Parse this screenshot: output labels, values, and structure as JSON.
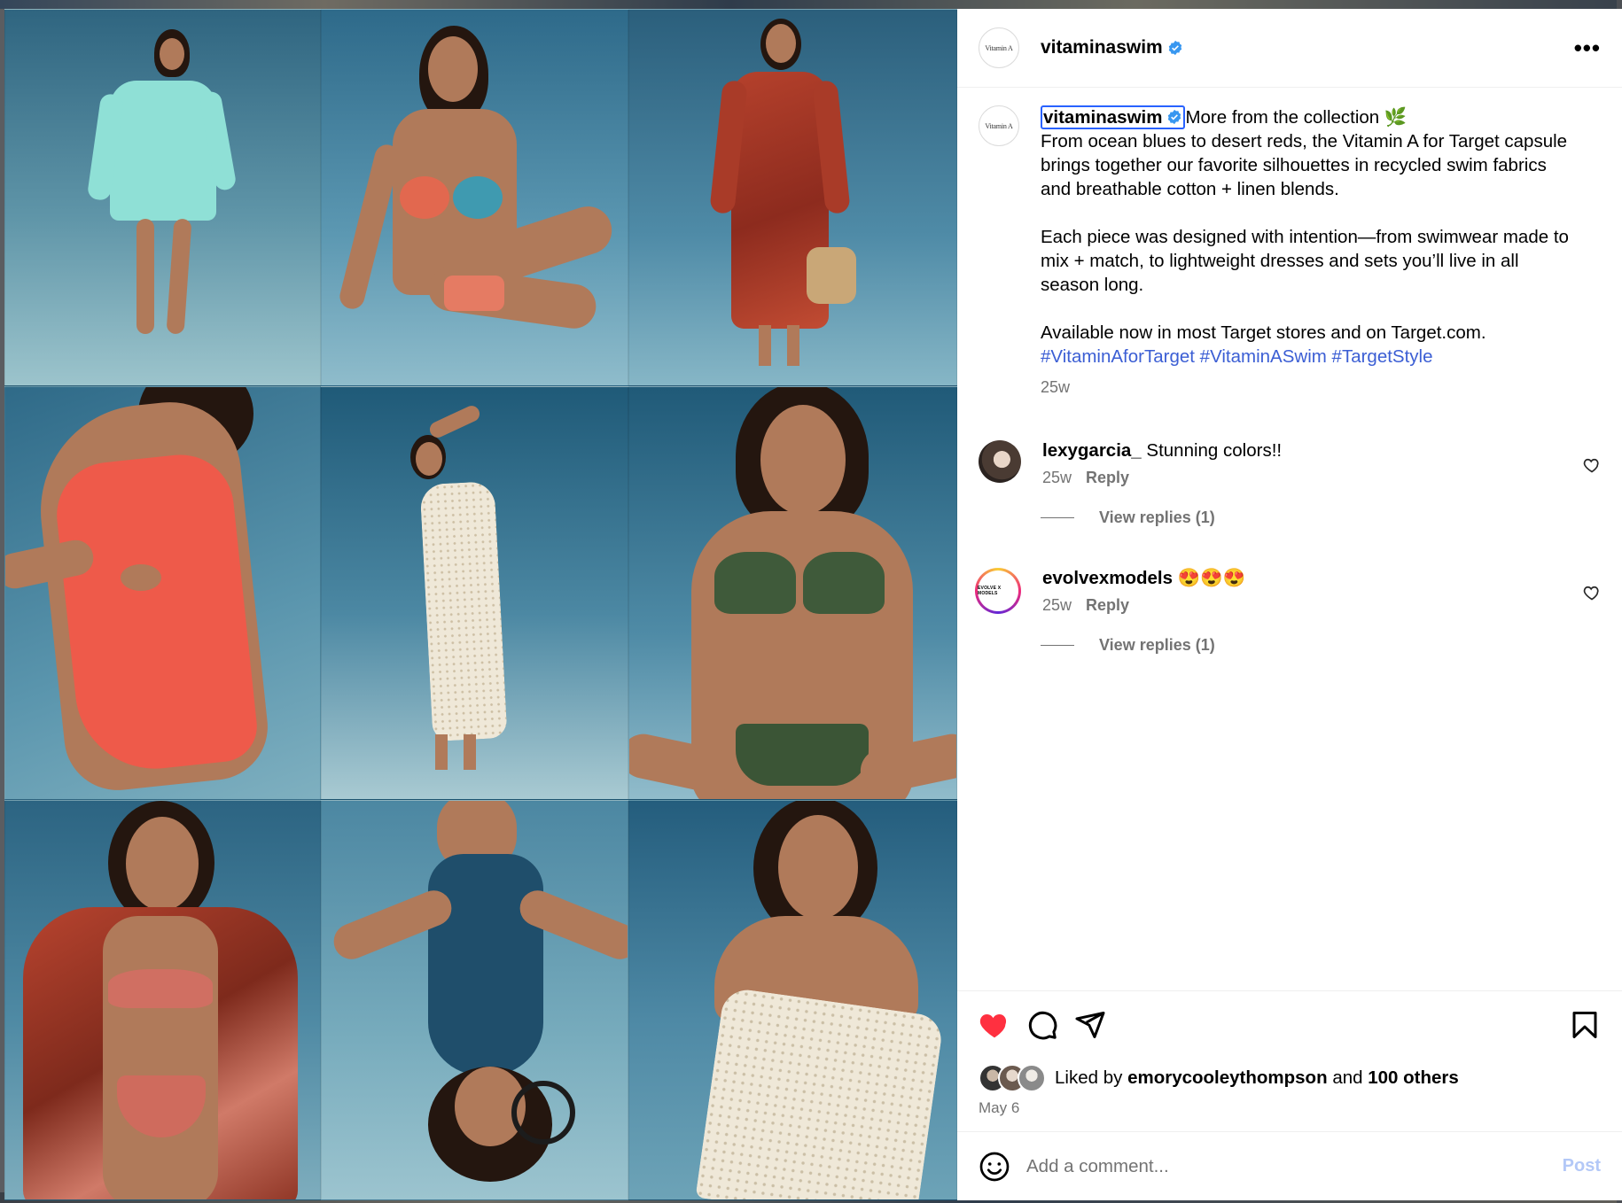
{
  "post": {
    "username": "vitaminaswim",
    "avatar_text": "Vitamin A",
    "verified_icon": "verified-badge-icon",
    "more_icon": "more-options-icon"
  },
  "caption": {
    "username": "vitaminaswim",
    "text_first": "More from the collection 🌿",
    "text_rest": "From ocean blues to desert reds, the Vitamin A for Target capsule brings together our favorite silhouettes in recycled swim fabrics and breathable cotton + linen blends.\n\nEach piece was designed with intention—from swimwear made to mix + match, to lightweight dresses and sets you’ll live in all season long.\n\nAvailable now in most Target stores and on Target.com.",
    "hashtags": [
      "#VitaminAforTarget",
      "#VitaminASwim",
      "#TargetStyle"
    ],
    "time": "25w"
  },
  "comments": [
    {
      "username": "lexygarcia_",
      "text": "Stunning colors!!",
      "time": "25w",
      "reply_label": "Reply",
      "view_replies": "View replies (1)"
    },
    {
      "username": "evolvexmodels",
      "text": "😍😍😍",
      "time": "25w",
      "reply_label": "Reply",
      "view_replies": "View replies (1)",
      "avatar_text": "EVOLVE X MODELS"
    }
  ],
  "likes": {
    "prefix": "Liked by",
    "top_user": "emorycooleythompson",
    "and": "and",
    "others": "100 others"
  },
  "date": "May 6",
  "add_comment": {
    "placeholder": "Add a comment...",
    "post_label": "Post"
  },
  "colors": {
    "heart": "#ff3040",
    "link": "#3b5ed4",
    "muted": "#737373",
    "post_button": "#b3c8f7",
    "focus_outline": "#2962ff"
  }
}
